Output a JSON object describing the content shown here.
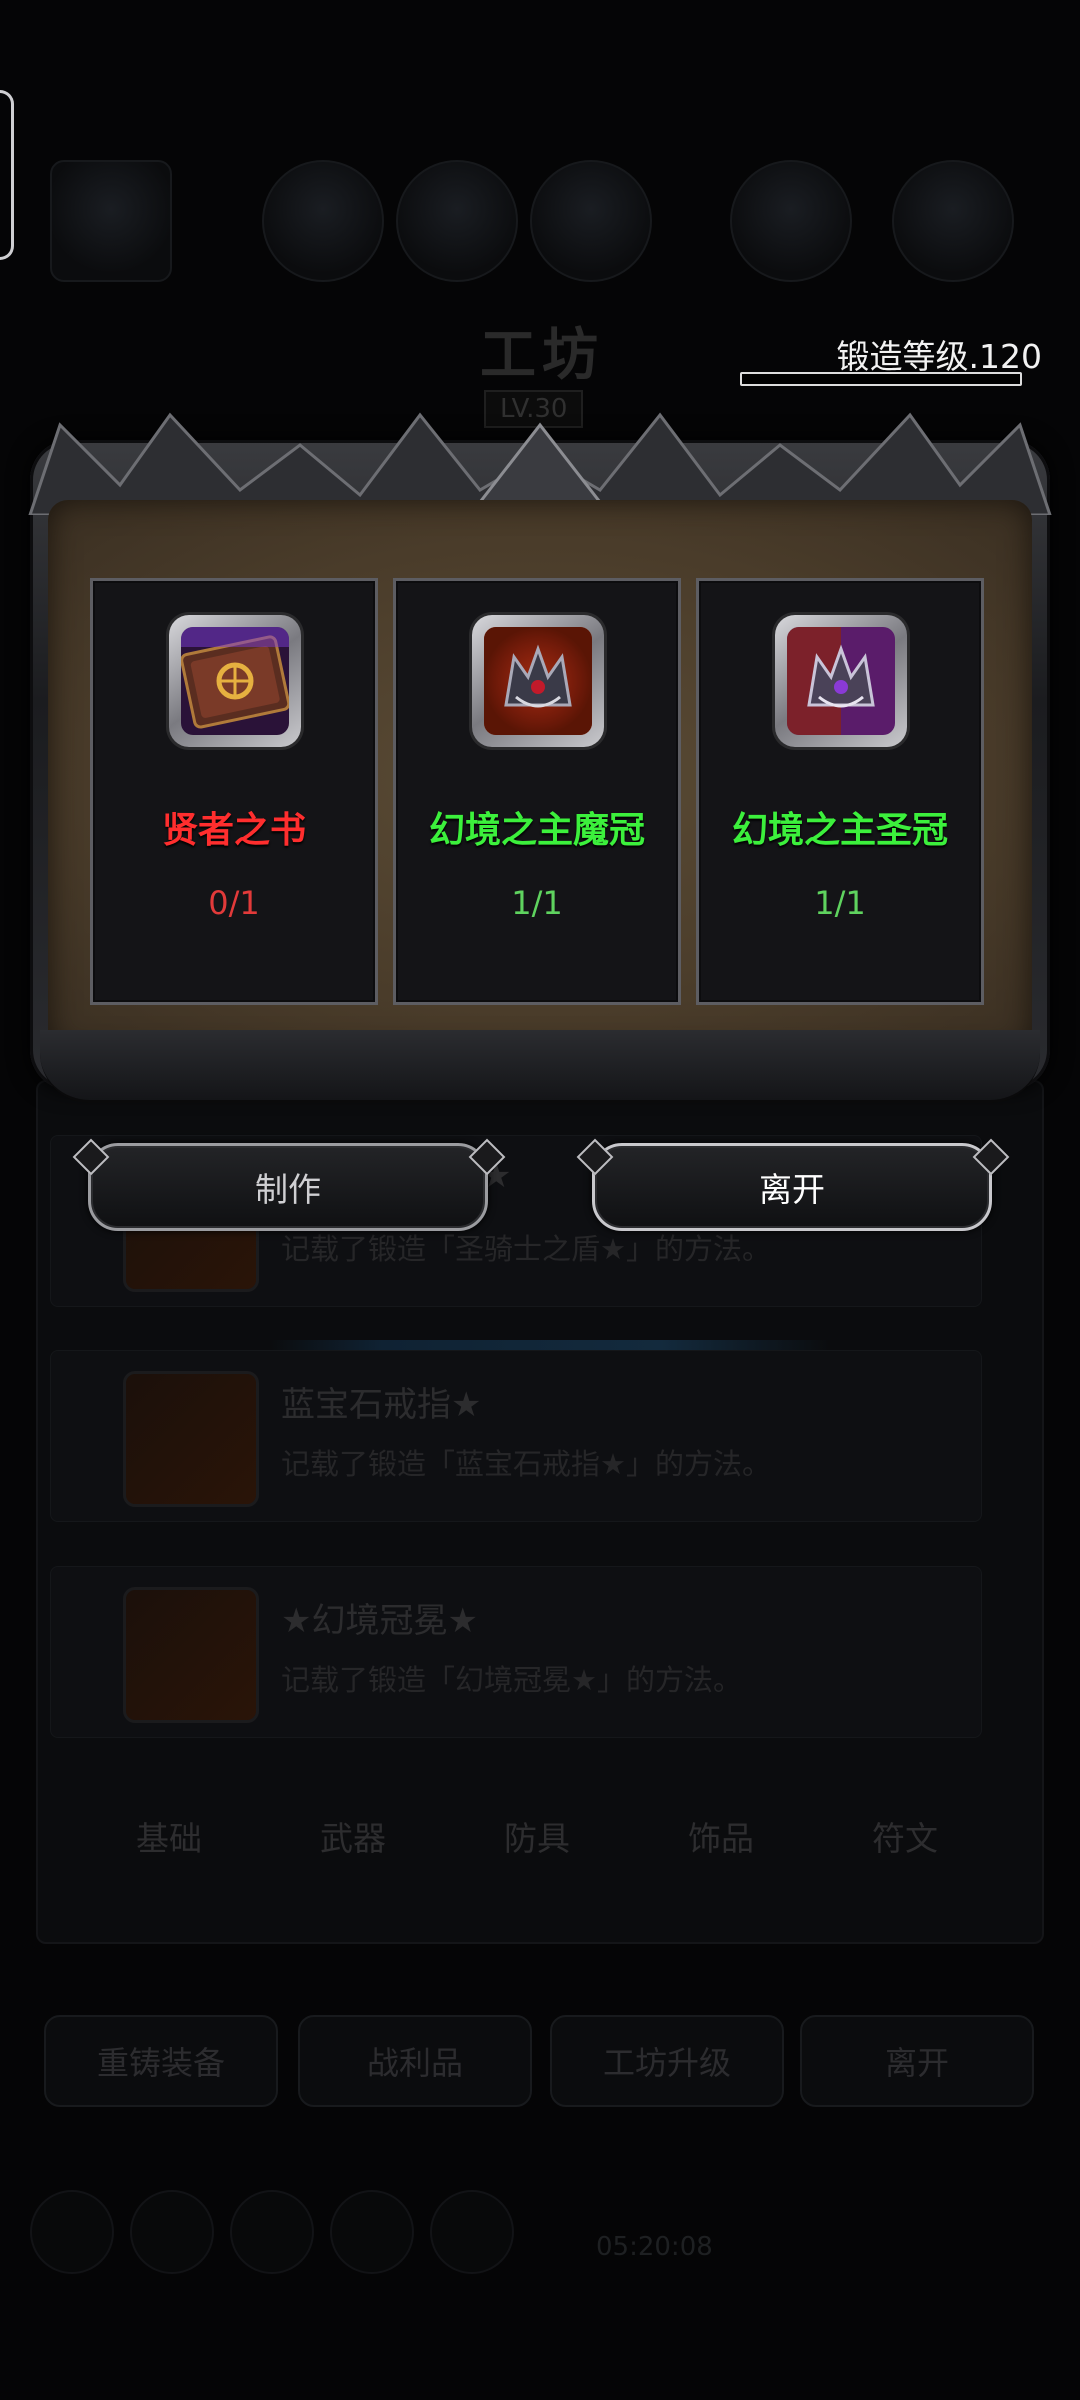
{
  "background": {
    "workshop_title": "工坊",
    "workshop_level": "LV.30",
    "forge_level": "锻造等级.120",
    "list_items": [
      {
        "name": "★",
        "desc": "记载了锻造「圣骑士之盾★」的方法。"
      },
      {
        "name": "蓝宝石戒指★",
        "desc": "记载了锻造「蓝宝石戒指★」的方法。"
      },
      {
        "name": "★幻境冠冕★",
        "desc": "记载了锻造「幻境冠冕★」的方法。"
      }
    ],
    "tabs": [
      "基础",
      "武器",
      "防具",
      "饰品",
      "符文"
    ],
    "bottom_buttons": [
      "重铸装备",
      "战利品",
      "工坊升级",
      "离开"
    ],
    "time": "05:20:08"
  },
  "dialog": {
    "materials": [
      {
        "name": "贤者之书",
        "count": "0/1",
        "status_color": "#ff2e2e",
        "icon": "book-icon"
      },
      {
        "name": "幻境之主魔冠",
        "count": "1/1",
        "status_color": "#3cf03c",
        "icon": "dark-crown-icon"
      },
      {
        "name": "幻境之主圣冠",
        "count": "1/1",
        "status_color": "#3cf03c",
        "icon": "holy-crown-icon"
      }
    ],
    "make_button": "制作",
    "leave_button": "离开"
  }
}
